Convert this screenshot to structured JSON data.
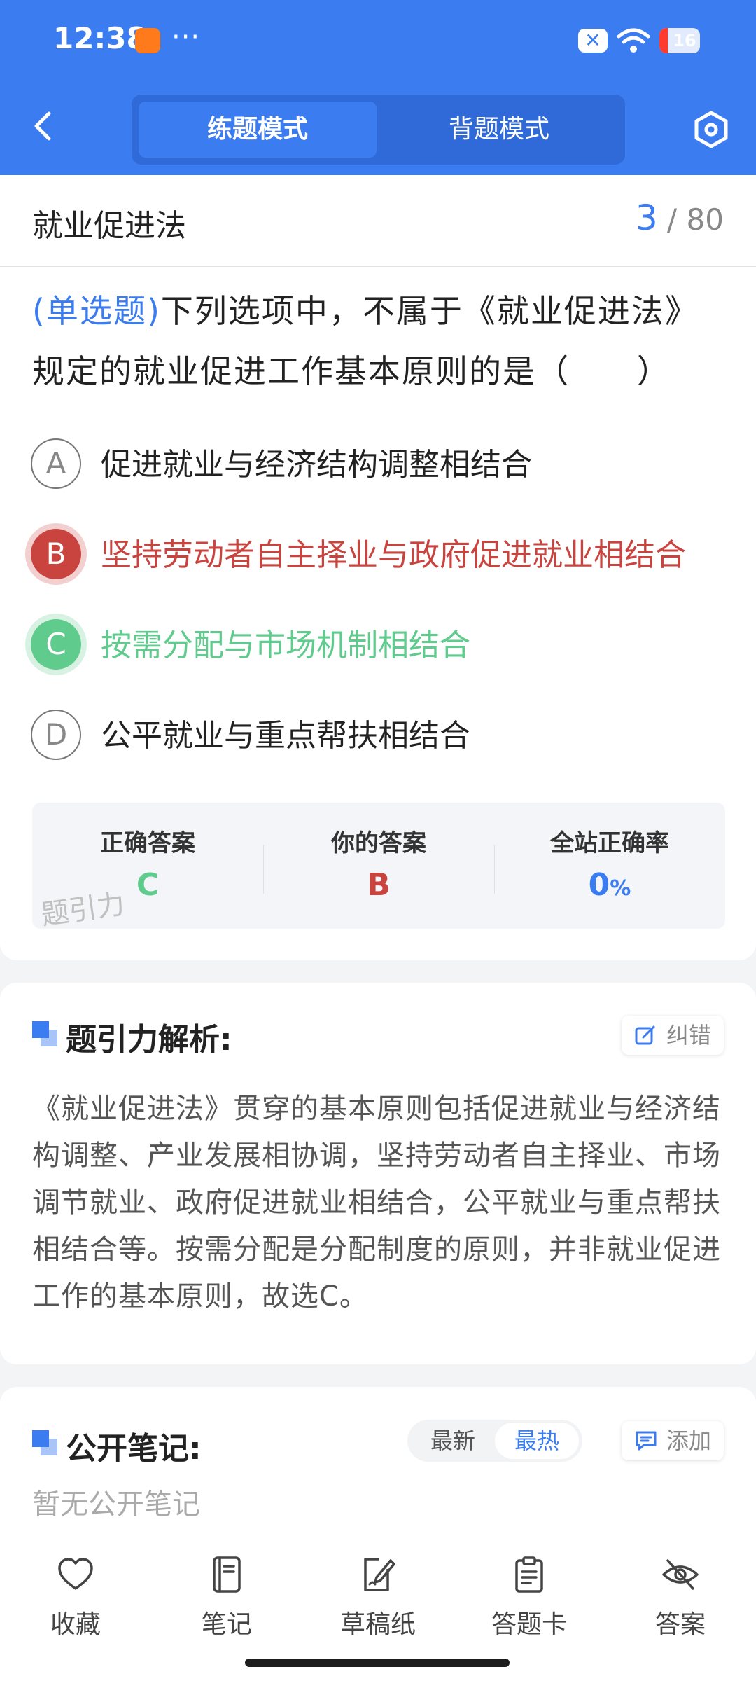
{
  "status_bar": {
    "time": "12:38",
    "dots": "···",
    "battery": "16"
  },
  "nav": {
    "tabs": [
      "练题模式",
      "背题模式"
    ],
    "active_tab": 0
  },
  "header": {
    "chapter_title": "就业促进法",
    "current": "3",
    "separator": "/",
    "total": "80"
  },
  "question": {
    "type_label": "(单选题)",
    "text": "下列选项中，不属于《就业促进法》规定的就业促进工作基本原则的是（　　）",
    "options": [
      {
        "letter": "A",
        "text": "促进就业与经济结构调整相结合",
        "state": "normal"
      },
      {
        "letter": "B",
        "text": "坚持劳动者自主择业与政府促进就业相结合",
        "state": "wrong"
      },
      {
        "letter": "C",
        "text": "按需分配与市场机制相结合",
        "state": "correct"
      },
      {
        "letter": "D",
        "text": "公平就业与重点帮扶相结合",
        "state": "normal"
      }
    ]
  },
  "answer_summary": {
    "correct_label": "正确答案",
    "correct_value": "C",
    "yours_label": "你的答案",
    "yours_value": "B",
    "rate_label": "全站正确率",
    "rate_value": "0",
    "rate_unit": "%",
    "watermark": "题引力",
    "colors": {
      "correct": "#5fcb8c",
      "wrong": "#c9443f",
      "rate": "#3b7cf0"
    }
  },
  "analysis": {
    "title": "题引力解析:",
    "report_label": "纠错",
    "text": "《就业促进法》贯穿的基本原则包括促进就业与经济结构调整、产业发展相协调，坚持劳动者自主择业、市场调节就业、政府促进就业相结合，公平就业与重点帮扶相结合等。按需分配是分配制度的原则，并非就业促进工作的基本原则，故选C。"
  },
  "notes": {
    "title": "公开笔记:",
    "sort_options": [
      "最新",
      "最热"
    ],
    "active_sort": 1,
    "add_label": "添加",
    "empty_text": "暂无公开笔记"
  },
  "bottom_bar": {
    "items": [
      {
        "label": "收藏",
        "icon": "heart-icon"
      },
      {
        "label": "笔记",
        "icon": "notebook-icon"
      },
      {
        "label": "草稿纸",
        "icon": "draft-icon"
      },
      {
        "label": "答题卡",
        "icon": "clipboard-icon"
      },
      {
        "label": "答案",
        "icon": "eye-off-icon"
      }
    ]
  },
  "theme": {
    "primary": "#3b7cf0",
    "correct": "#5fcb8c",
    "wrong": "#c9443f"
  }
}
